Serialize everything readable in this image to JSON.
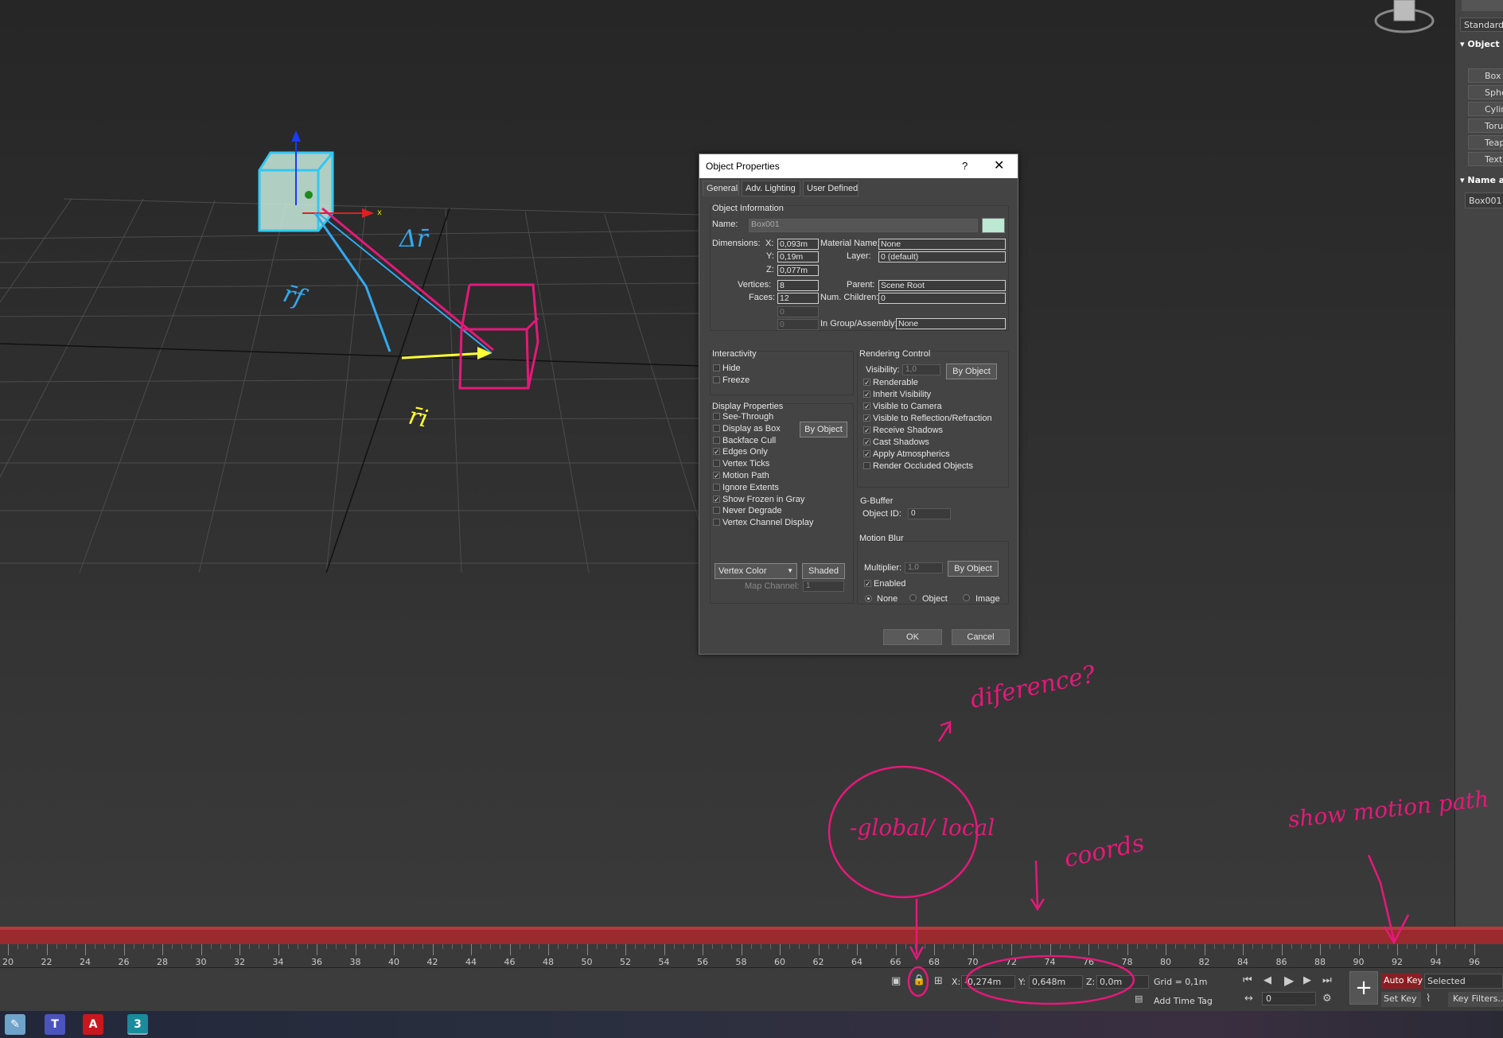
{
  "viewport": {
    "gizmo_label": "x",
    "vector_labels": {
      "delta_r": "Δr̄",
      "r_f": "r̄f",
      "r_i": "r̄i"
    }
  },
  "command_panel": {
    "dropdown": "Standard P",
    "rollout_object": "Object",
    "objects": [
      "Box",
      "Spher",
      "Cylinde",
      "Torus",
      "Teapo",
      "TextPl"
    ],
    "rollout_name": "Name a",
    "name_value": "Box001"
  },
  "dialog": {
    "title": "Object Properties",
    "help": "?",
    "close": "✕",
    "tabs": [
      "General",
      "Adv. Lighting",
      "User Defined"
    ],
    "object_info": {
      "label": "Object Information",
      "name_label": "Name:",
      "name_value": "Box001",
      "swatch_color": "#bde8d4",
      "dimensions_label": "Dimensions:",
      "x_label": "X:",
      "x_value": "0,093m",
      "y_label": "Y:",
      "y_value": "0,19m",
      "z_label": "Z:",
      "z_value": "0,077m",
      "material_label": "Material Name:",
      "material_value": "None",
      "layer_label": "Layer:",
      "layer_value": "0 (default)",
      "vertices_label": "Vertices:",
      "vertices_value": "8",
      "faces_label": "Faces:",
      "faces_value": "12",
      "parent_label": "Parent:",
      "parent_value": "Scene Root",
      "children_label": "Num. Children:",
      "children_value": "0",
      "extra1": "0",
      "extra2": "0",
      "group_label": "In Group/Assembly:",
      "group_value": "None"
    },
    "interactivity": {
      "label": "Interactivity",
      "items": [
        {
          "label": "Hide",
          "checked": false
        },
        {
          "label": "Freeze",
          "checked": false
        }
      ]
    },
    "display": {
      "label": "Display Properties",
      "by_object": "By Object",
      "items": [
        {
          "label": "See-Through",
          "checked": false
        },
        {
          "label": "Display as Box",
          "checked": false
        },
        {
          "label": "Backface Cull",
          "checked": false
        },
        {
          "label": "Edges Only",
          "checked": true
        },
        {
          "label": "Vertex Ticks",
          "checked": false
        },
        {
          "label": "Motion Path",
          "checked": true
        },
        {
          "label": "Ignore Extents",
          "checked": false
        },
        {
          "label": "Show Frozen in Gray",
          "checked": true
        },
        {
          "label": "Never Degrade",
          "checked": false
        },
        {
          "label": "Vertex Channel Display",
          "checked": false
        }
      ],
      "vertex_color": "Vertex Color",
      "shaded": "Shaded",
      "map_channel_label": "Map Channel:",
      "map_channel_value": "1"
    },
    "rendering": {
      "label": "Rendering Control",
      "visibility_label": "Visibility:",
      "visibility_value": "1,0",
      "by_object": "By Object",
      "items": [
        {
          "label": "Renderable",
          "checked": true
        },
        {
          "label": "Inherit Visibility",
          "checked": true
        },
        {
          "label": "Visible to Camera",
          "checked": true
        },
        {
          "label": "Visible to Reflection/Refraction",
          "checked": true
        },
        {
          "label": "Receive Shadows",
          "checked": true
        },
        {
          "label": "Cast Shadows",
          "checked": true
        },
        {
          "label": "Apply Atmospherics",
          "checked": true
        },
        {
          "label": "Render Occluded Objects",
          "checked": false
        }
      ],
      "gbuffer_label": "G-Buffer",
      "objectid_label": "Object ID:",
      "objectid_value": "0"
    },
    "motion_blur": {
      "label": "Motion Blur",
      "multiplier_label": "Multiplier:",
      "multiplier_value": "1,0",
      "by_object": "By Object",
      "enabled_label": "Enabled",
      "enabled_checked": true,
      "radios": [
        {
          "label": "None",
          "selected": true
        },
        {
          "label": "Object",
          "selected": false
        },
        {
          "label": "Image",
          "selected": false
        }
      ]
    },
    "ok": "OK",
    "cancel": "Cancel"
  },
  "timeline": {
    "ticks": [
      "20",
      "22",
      "24",
      "26",
      "28",
      "30",
      "32",
      "34",
      "36",
      "38",
      "40",
      "42",
      "44",
      "46",
      "48",
      "50",
      "52",
      "54",
      "56",
      "58",
      "60",
      "62",
      "64",
      "66",
      "68",
      "70",
      "72",
      "74",
      "76",
      "78",
      "80",
      "82",
      "84",
      "86",
      "88",
      "90",
      "92",
      "94",
      "96"
    ]
  },
  "statusbar": {
    "x_label": "X:",
    "x_value": "-0,274m",
    "y_label": "Y:",
    "y_value": "0,648m",
    "z_label": "Z:",
    "z_value": "0,0m",
    "grid": "Grid = 0,1m",
    "add_time_tag": "Add Time Tag",
    "auto_key": "Auto Key",
    "selected": "Selected",
    "set_key": "Set Key",
    "key_filters": "Key Filters...",
    "frame_value": "0"
  },
  "annotations": {
    "difference": "diference?",
    "global_local": "-global/ local",
    "coords": "coords",
    "show_motion_path": "show motion path"
  },
  "colors": {
    "annotation": "#e4197a",
    "box_cyan": "#33c8f0",
    "vector_yellow": "#ffff33",
    "timebar": "#9b2a2e"
  }
}
